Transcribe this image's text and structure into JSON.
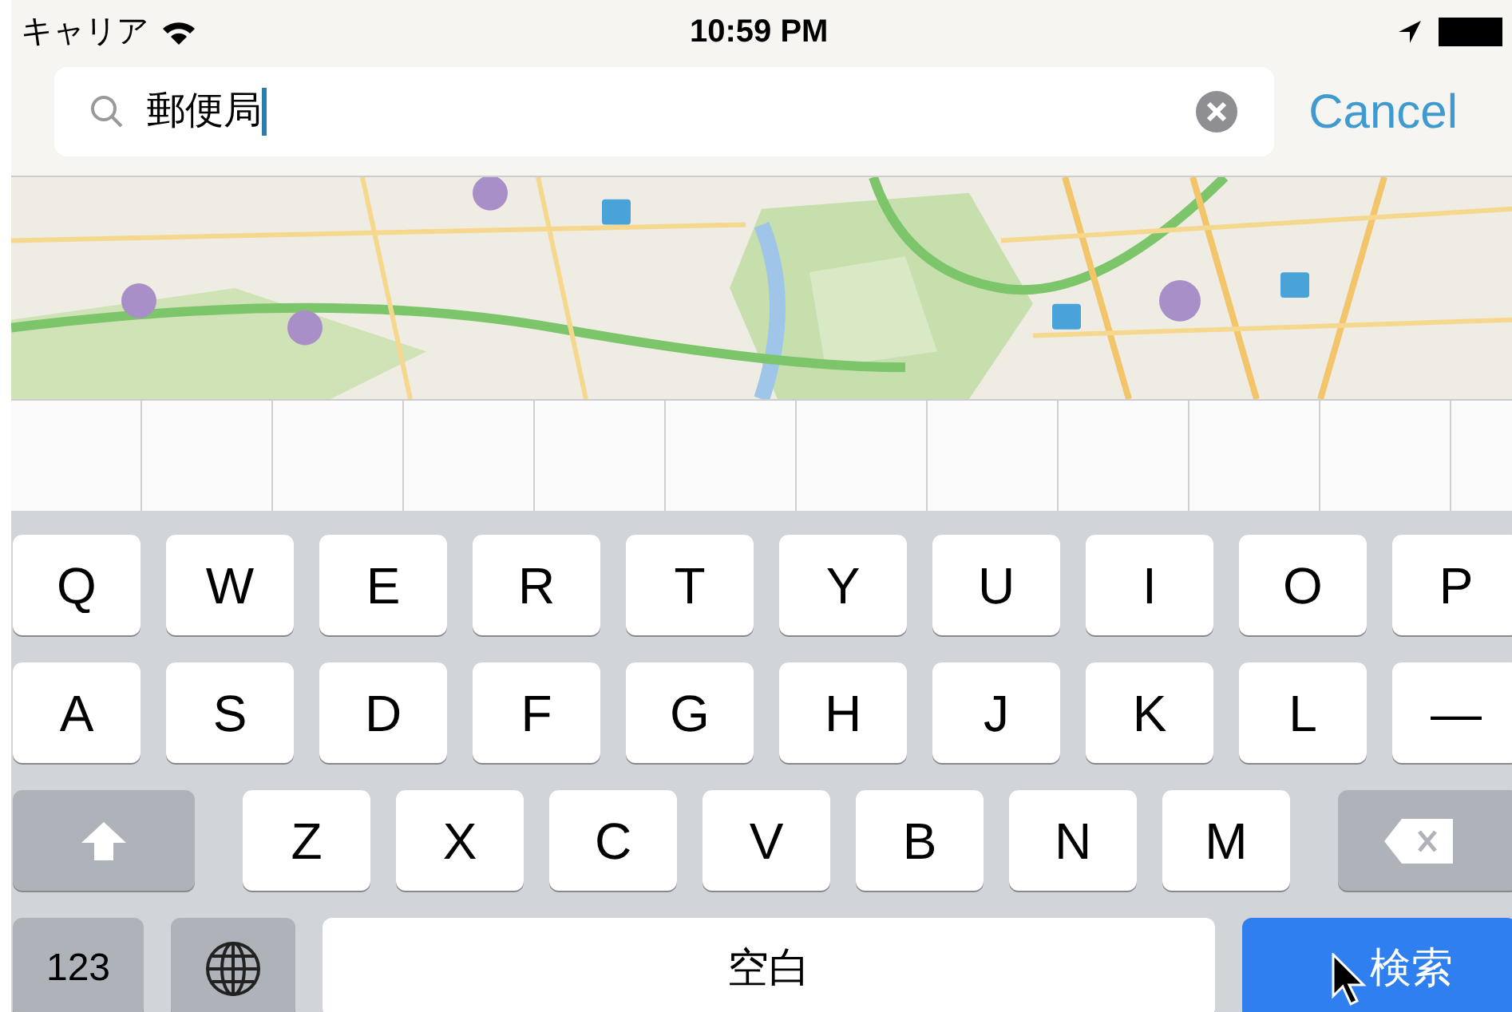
{
  "status_bar": {
    "carrier": "キャリア",
    "time": "10:59 PM"
  },
  "search": {
    "value": "郵便局",
    "cancel": "Cancel"
  },
  "keyboard": {
    "rows": [
      {
        "keys": [
          {
            "kind": "letter",
            "label": "Q"
          },
          {
            "kind": "letter",
            "label": "W"
          },
          {
            "kind": "letter",
            "label": "E"
          },
          {
            "kind": "letter",
            "label": "R"
          },
          {
            "kind": "letter",
            "label": "T"
          },
          {
            "kind": "letter",
            "label": "Y"
          },
          {
            "kind": "letter",
            "label": "U"
          },
          {
            "kind": "letter",
            "label": "I"
          },
          {
            "kind": "letter",
            "label": "O"
          },
          {
            "kind": "letter",
            "label": "P"
          }
        ]
      },
      {
        "keys": [
          {
            "kind": "letter",
            "label": "A"
          },
          {
            "kind": "letter",
            "label": "S"
          },
          {
            "kind": "letter",
            "label": "D"
          },
          {
            "kind": "letter",
            "label": "F"
          },
          {
            "kind": "letter",
            "label": "G"
          },
          {
            "kind": "letter",
            "label": "H"
          },
          {
            "kind": "letter",
            "label": "J"
          },
          {
            "kind": "letter",
            "label": "K"
          },
          {
            "kind": "letter",
            "label": "L"
          },
          {
            "kind": "letter",
            "label": "—"
          }
        ]
      },
      {
        "keys": [
          {
            "kind": "shift"
          },
          {
            "kind": "letter",
            "label": "Z"
          },
          {
            "kind": "letter",
            "label": "X"
          },
          {
            "kind": "letter",
            "label": "C"
          },
          {
            "kind": "letter",
            "label": "V"
          },
          {
            "kind": "letter",
            "label": "B"
          },
          {
            "kind": "letter",
            "label": "N"
          },
          {
            "kind": "letter",
            "label": "M"
          },
          {
            "kind": "delete"
          }
        ]
      },
      {
        "keys": [
          {
            "kind": "numbers",
            "label": "123"
          },
          {
            "kind": "globe"
          },
          {
            "kind": "space",
            "label": "空白"
          },
          {
            "kind": "search",
            "label": "検索"
          }
        ]
      }
    ]
  }
}
